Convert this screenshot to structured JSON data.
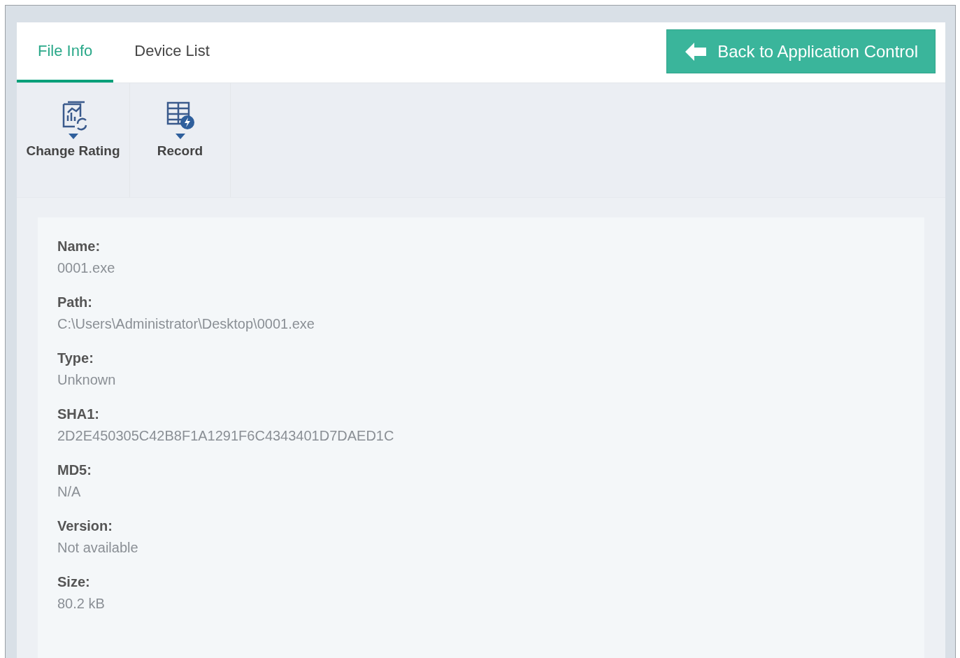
{
  "tabs": [
    {
      "label": "File Info",
      "selected": true
    },
    {
      "label": "Device List",
      "selected": false
    }
  ],
  "back_button": {
    "label": "Back to Application Control"
  },
  "toolbar": [
    {
      "label": "Change Rating"
    },
    {
      "label": "Record"
    }
  ],
  "fields": [
    {
      "label": "Name:",
      "value": "0001.exe"
    },
    {
      "label": "Path:",
      "value": "C:\\Users\\Administrator\\Desktop\\0001.exe"
    },
    {
      "label": "Type:",
      "value": "Unknown"
    },
    {
      "label": "SHA1:",
      "value": "2D2E450305C42B8F1A1291F6C4343401D7DAED1C"
    },
    {
      "label": "MD5:",
      "value": "N/A"
    },
    {
      "label": "Version:",
      "value": "Not available"
    },
    {
      "label": "Size:",
      "value": "80.2 kB"
    }
  ]
}
